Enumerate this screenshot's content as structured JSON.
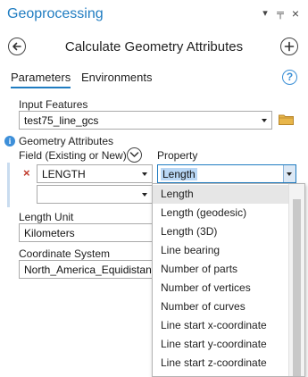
{
  "pane": {
    "title": "Geoprocessing",
    "dropdown_glyph": "▾",
    "pin_glyph": "╤",
    "close_glyph": "×"
  },
  "tool": {
    "title": "Calculate Geometry Attributes"
  },
  "tabs": [
    {
      "label": "Parameters",
      "active": true
    },
    {
      "label": "Environments",
      "active": false
    }
  ],
  "help_glyph": "?",
  "input_features": {
    "label": "Input Features",
    "value": "test75_line_gcs"
  },
  "geometry_attributes": {
    "label": "Geometry Attributes",
    "field_header": "Field (Existing or New)",
    "property_header": "Property",
    "remove_glyph": "×",
    "rows": [
      {
        "field": "LENGTH",
        "property": "Length"
      },
      {
        "field": "",
        "property": ""
      }
    ]
  },
  "length_unit": {
    "label": "Length Unit",
    "value": "Kilometers"
  },
  "coordinate_system": {
    "label": "Coordinate System",
    "value": "North_America_Equidistant_Conic"
  },
  "property_dropdown": {
    "options": [
      "Length",
      "Length (geodesic)",
      "Length (3D)",
      "Line bearing",
      "Number of parts",
      "Number of vertices",
      "Number of curves",
      "Line start x-coordinate",
      "Line start y-coordinate",
      "Line start z-coordinate"
    ],
    "highlighted": "Length"
  },
  "colors": {
    "accent": "#1f7cc1",
    "selection": "#b9d7f5",
    "remove": "#c0392b",
    "folder": "#e8b64a"
  }
}
